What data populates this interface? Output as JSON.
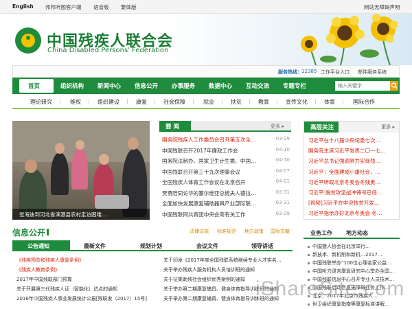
{
  "topbar": {
    "english": "English",
    "client": "邦邦听图客户端",
    "voice": "语音版",
    "traditional": "繁体版",
    "accessibility": "网站无障碍声明"
  },
  "brand": {
    "name_cn": "中国残疾人联合会",
    "name_en": "China Disabled Persons' Federation",
    "green": "#1e8c3c",
    "yellow": "#f2c200"
  },
  "service_bar": {
    "hotline_label": "服务热线：",
    "hotline_number": "12385",
    "portal": "工作平台入口",
    "mail": "邮件服务系统"
  },
  "main_nav": [
    "首页",
    "组织机构",
    "新闻中心",
    "信息公开",
    "办事服务",
    "数据中心",
    "互动交流",
    "专题专栏"
  ],
  "search": {
    "placeholder": "输入关键字"
  },
  "sub_nav": [
    "理论研究",
    "维权",
    "组织建设",
    "康复",
    "社会保障",
    "就业",
    "扶贫",
    "教育",
    "宣传文化",
    "体育",
    "国际合作"
  ],
  "photo": {
    "caption": "张海迪到河北省涞源县农村走访困难…"
  },
  "news": {
    "title": "要  闻",
    "more": "更多",
    "items": [
      {
        "text": "国务院残疾人工作委员会召开第五次全…",
        "date": "03-29",
        "highlight": true
      },
      {
        "text": "中国残联召开2017年廉政工作会",
        "date": "04-10",
        "highlight": false
      },
      {
        "text": "国务院法制办、国家卫生计生委、中国…",
        "date": "04-10",
        "highlight": false
      },
      {
        "text": "中国残联召开第三十九次理事会议",
        "date": "04-07",
        "highlight": false
      },
      {
        "text": "全国残疾人体育工作会议在北京召开",
        "date": "04-01",
        "highlight": false
      },
      {
        "text": "贾勇陪同访华的塞尔维亚总统夫人德拉…",
        "date": "03-31",
        "highlight": false
      },
      {
        "text": "全面加快发展康复辅助器具产业部际联…",
        "date": "03-31",
        "highlight": false
      },
      {
        "text": "中国残联同共青团中央会商有关工作",
        "date": "03-29",
        "highlight": false
      }
    ]
  },
  "focus": {
    "title": "高层关注",
    "more": "更多",
    "items": [
      "习近平在十八届中央纪委七次…",
      "国务院主席习近平发表二〇一七…",
      "习近平总书记强调努力实现残…",
      "习近平：全面建成小康社会，…",
      "习近平听取北京冬奥会冬残奥…",
      "习近平:脱贫攻坚战冲锋号已经…",
      "[视频]习近平在中央扶贫开发…",
      "习近平指示办好北京冬奥会·冬…"
    ]
  },
  "info": {
    "title": "信息公开",
    "links": [
      "法律法规",
      "标准规范",
      "地方政策",
      "国际文献"
    ],
    "tabs": [
      "公告通知",
      "最新文件",
      "规划计划",
      "会议文件",
      "领导讲话"
    ],
    "left_items": [
      {
        "text": "《残疾预防和残疾人康复条例》",
        "highlight": true
      },
      {
        "text": "《残疾人教育条例》",
        "highlight": true
      },
      {
        "text": "2017年中国残联部门预算",
        "highlight": false
      },
      {
        "text": "关于开展第三代残疾人证（智能化）试点的通知",
        "highlight": false
      },
      {
        "text": "2016年中国残疾人事业发展统计公报[残联发（2017）15号]",
        "highlight": false
      }
    ],
    "right_items": [
      "关于印发《2017年度全国残联系统继续专业人才实名…",
      "关于举办残疾人服务机构人员培训班的通知",
      "关于征集助残社会组织优秀案例的通知",
      "关于举办第二期康复辅具、健身体育指导训练班的通知",
      "关于举办第二期康复辅具、健身体育指导训练班的通知"
    ]
  },
  "affairs": {
    "tabs": [
      "业务工作",
      "地方动态"
    ],
    "items": [
      "中国聋人协会在北京举行…",
      "新技术、新机制和新机…2017…",
      "中国残联举办“100位心理名家公益…",
      "中国听力语言康复研究中心举办全国…",
      "中国残联信息中心召开专业人员技术…",
      "中国残联启动信息无障碍业务工作…",
      "北京：2017年北京市残疾人…",
      "世卫组织康复指南等康复标准讲解…"
    ]
  },
  "watermark": "iShareSite.com"
}
